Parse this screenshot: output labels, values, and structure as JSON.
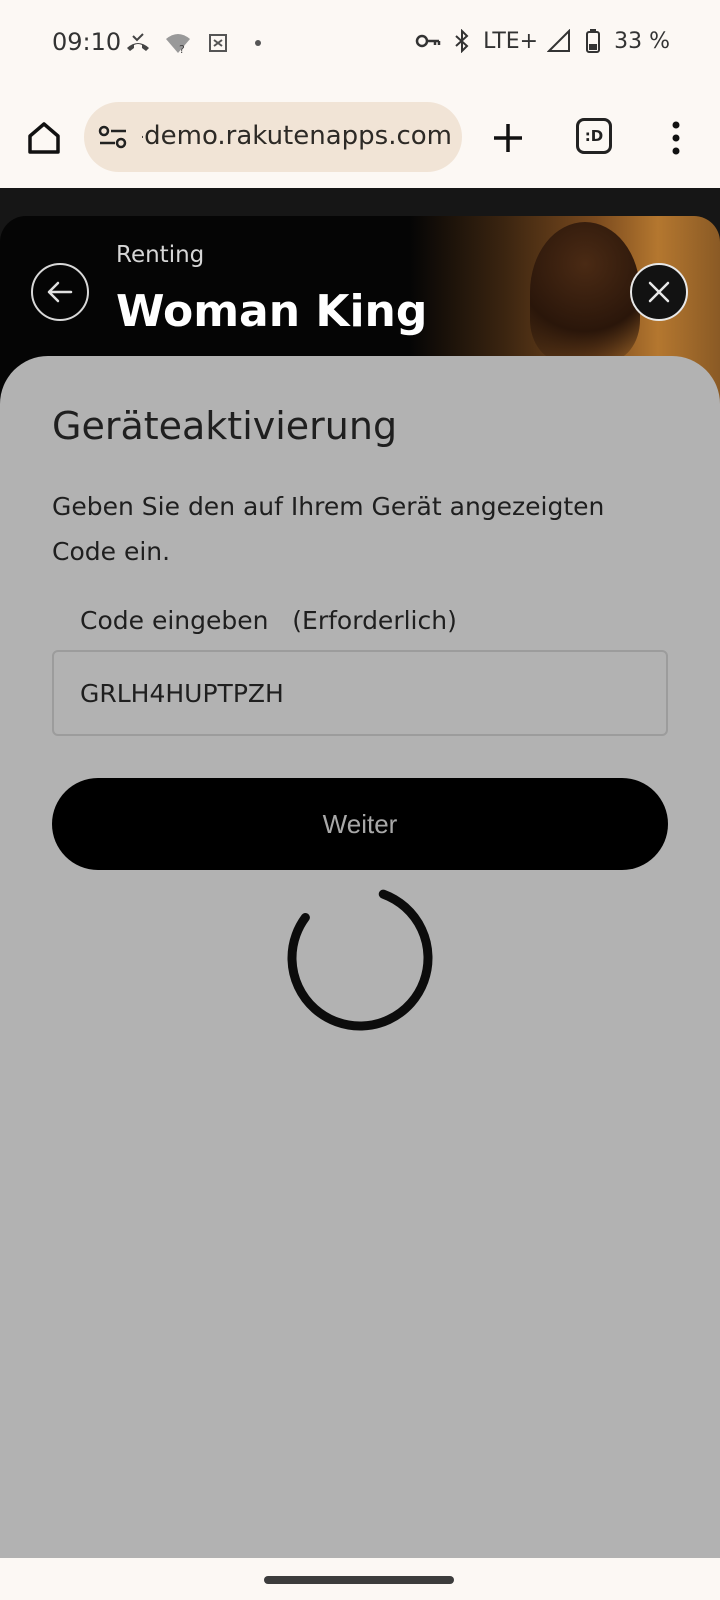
{
  "status_bar": {
    "time": "09:10",
    "battery_text": "33 %",
    "network_text": "LTE+",
    "icons": [
      "missed-call-icon",
      "wifi-question-icon",
      "vpn-icon",
      "dot-icon",
      "key-icon",
      "bluetooth-icon",
      "signal-icon",
      "battery-icon"
    ]
  },
  "browser": {
    "url": "e-demo.rakutenapps.com",
    "tabs_label": ":D"
  },
  "hero": {
    "subtitle": "Renting",
    "title": "Woman King"
  },
  "sheet": {
    "title": "Geräteaktivierung",
    "description": "Geben Sie den auf Ihrem Gerät angezeigten Code ein.",
    "field_label": "Code eingeben   (Erforderlich)",
    "code_value": "GRLH4HUPTPZH",
    "continue_label": "Weiter"
  },
  "colors": {
    "sheet_bg": "#b2b2b2",
    "button_bg": "#000000",
    "browser_bg": "#fcf8f4",
    "url_pill": "#f1e4d6"
  }
}
